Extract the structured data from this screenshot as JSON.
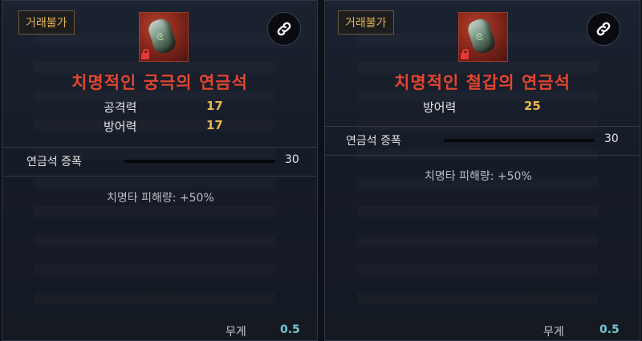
{
  "cards": [
    {
      "trade_tag": "거래불가",
      "icon": "alchemy-stone-icon",
      "item_name": "치명적인 궁극의 연금석",
      "stats": [
        {
          "label": "공격력",
          "value": "17"
        },
        {
          "label": "방어력",
          "value": "17"
        }
      ],
      "amplification": {
        "label": "연금석 증폭",
        "value": "30"
      },
      "effect": "치명타 피해량: +50%",
      "weight": {
        "label": "무게",
        "value": "0.5"
      }
    },
    {
      "trade_tag": "거래불가",
      "icon": "alchemy-stone-icon",
      "item_name": "치명적인 철갑의 연금석",
      "stats": [
        {
          "label": "방어력",
          "value": "25"
        }
      ],
      "amplification": {
        "label": "연금석 증폭",
        "value": "30"
      },
      "effect": "치명타 피해량: +50%",
      "weight": {
        "label": "무게",
        "value": "0.5"
      }
    }
  ],
  "colors": {
    "name": "#e2452f",
    "stat_value": "#e8b94c",
    "weight_value": "#74c7cf",
    "trade_tag": "#e1b458"
  }
}
